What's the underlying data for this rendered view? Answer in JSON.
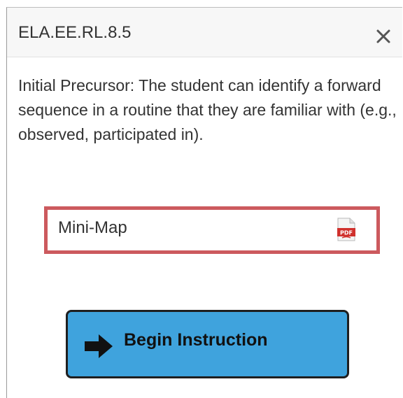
{
  "popover": {
    "title": "ELA.EE.RL.8.5",
    "description": "Initial Precursor: The student can identify a forward sequence in a routine that they are familiar with (e.g., observed, participated in).",
    "close_icon": "close-icon"
  },
  "minimap": {
    "label": "Mini-Map",
    "icon": "pdf-icon",
    "highlight_color": "#cc5a5e"
  },
  "begin_button": {
    "label": "Begin Instruction",
    "icon": "arrow-right-icon",
    "background_color": "#3fa3dd"
  }
}
